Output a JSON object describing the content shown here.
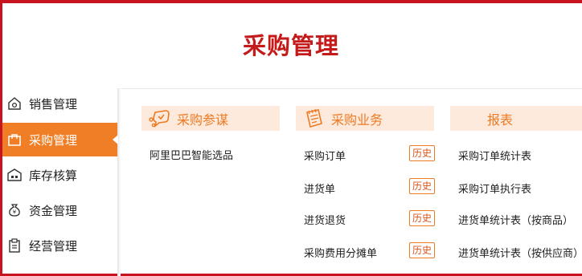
{
  "page": {
    "title": "采购管理"
  },
  "sidebar": {
    "items": [
      {
        "label": "销售管理",
        "icon": "sales-icon"
      },
      {
        "label": "采购管理",
        "icon": "purchase-bag-icon",
        "active": true
      },
      {
        "label": "库存核算",
        "icon": "warehouse-icon"
      },
      {
        "label": "资金管理",
        "icon": "money-bag-icon"
      },
      {
        "label": "经营管理",
        "icon": "clipboard-icon"
      }
    ]
  },
  "sections": {
    "advisor": {
      "title": "采购参谋",
      "icon": "message-cursor-icon",
      "items": [
        {
          "label": "阿里巴巴智能选品"
        }
      ]
    },
    "business": {
      "title": "采购业务",
      "icon": "notepad-icon",
      "history_label": "历史",
      "items": [
        {
          "label": "采购订单"
        },
        {
          "label": "进货单"
        },
        {
          "label": "进货退货"
        },
        {
          "label": "采购费用分摊单"
        }
      ]
    },
    "reports": {
      "title": "报表",
      "items": [
        {
          "label": "采购订单统计表"
        },
        {
          "label": "采购订单执行表"
        },
        {
          "label": "进货单统计表（按商品）"
        },
        {
          "label": "进货单统计表（按供应商）"
        }
      ]
    }
  },
  "colors": {
    "accent": "#f07e26",
    "title_red": "#c41a1a",
    "frame": "#c8141e",
    "section_bg": "#fdeadd"
  }
}
